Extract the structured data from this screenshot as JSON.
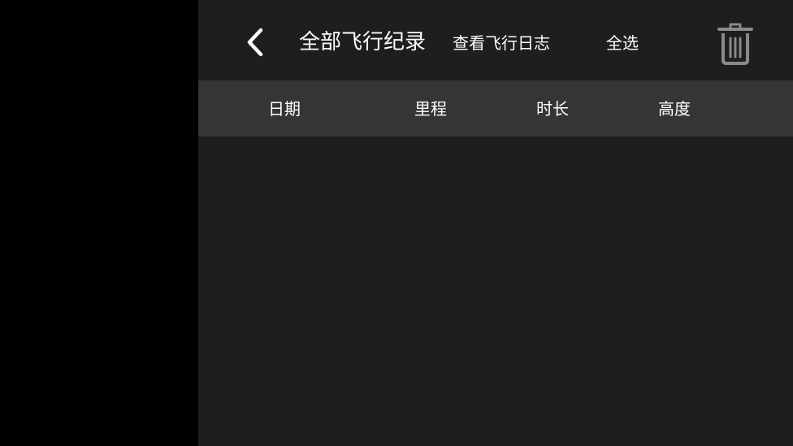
{
  "header": {
    "back_icon": "chevron-left-icon",
    "title": "全部飞行纪录",
    "view_log_label": "查看飞行日志",
    "select_all_label": "全选",
    "delete_icon": "trash-icon"
  },
  "table": {
    "columns": [
      {
        "label": "日期"
      },
      {
        "label": "里程"
      },
      {
        "label": "时长"
      },
      {
        "label": "高度"
      }
    ],
    "rows": []
  },
  "colors": {
    "background": "#1e1e1e",
    "header_row": "#353535",
    "left_panel": "#000000",
    "text": "#ffffff",
    "icon_gray": "#8a8a8a"
  }
}
